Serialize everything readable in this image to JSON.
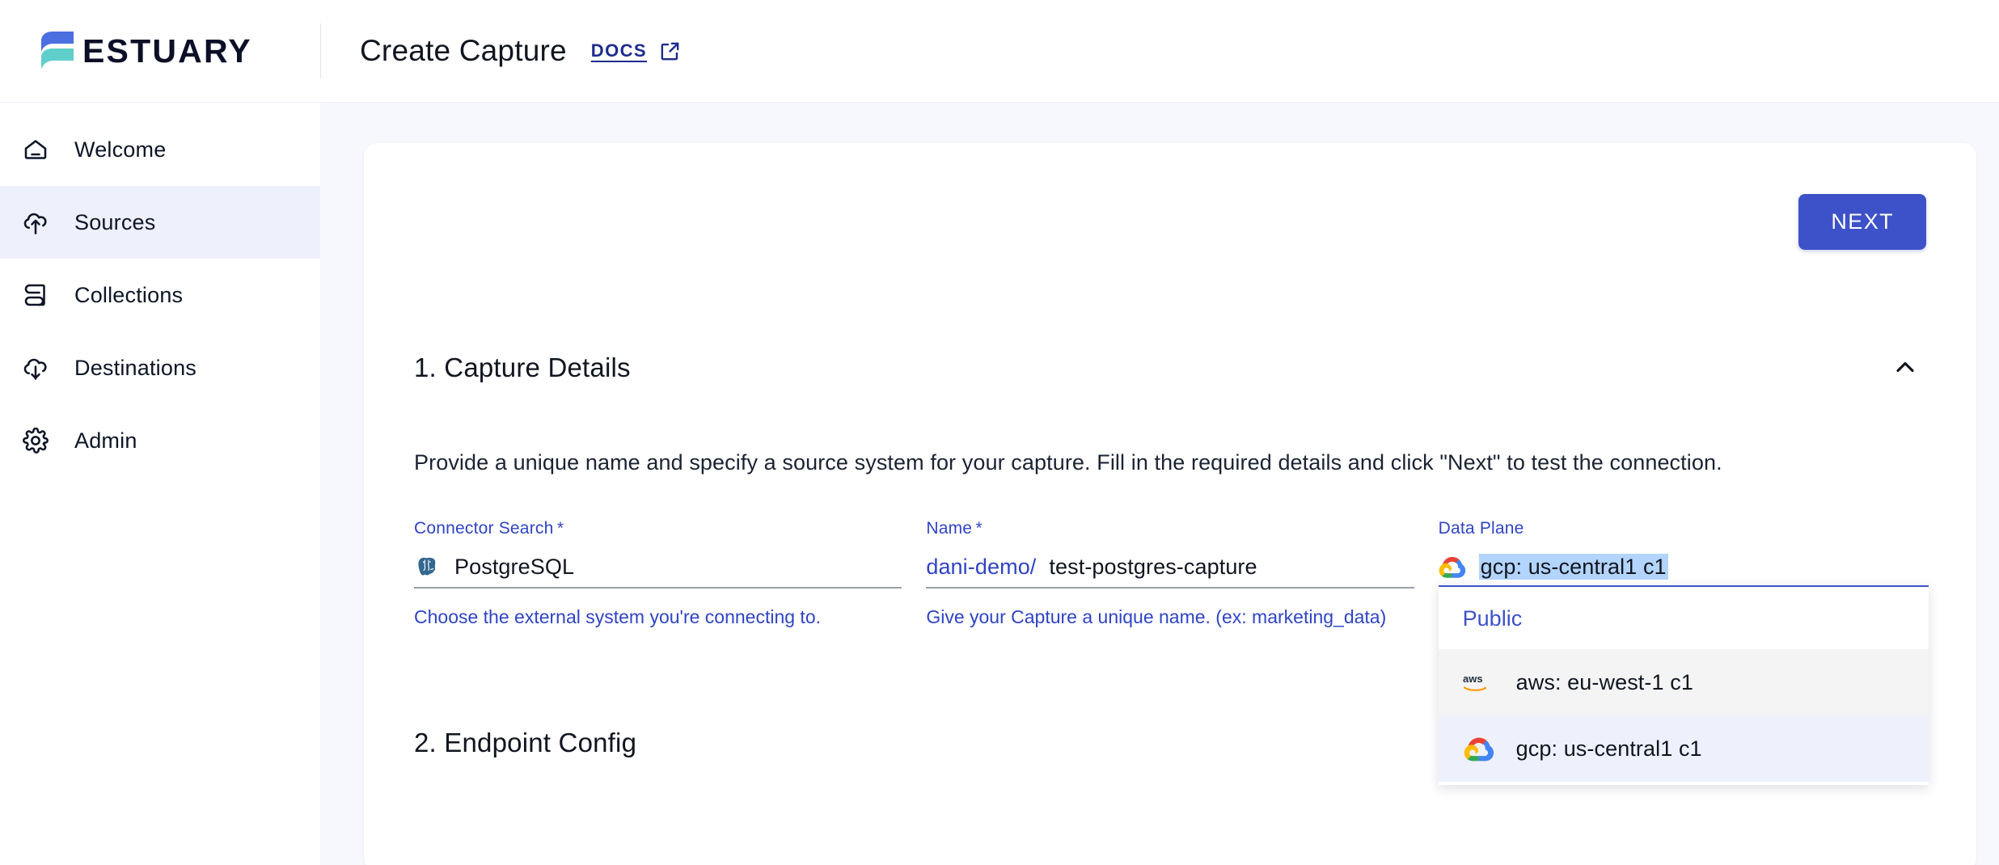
{
  "header": {
    "brand_name": "ESTUARY",
    "page_title": "Create Capture",
    "docs_label": "DOCS",
    "docs_icon": "external-link-icon",
    "logo_icon": "estuary-logo-icon",
    "colors": {
      "logo_blue": "#4b6ee0",
      "logo_teal": "#5fcfcb",
      "link": "#1d2c8e"
    }
  },
  "sidebar": {
    "items": [
      {
        "label": "Welcome",
        "icon": "home-icon",
        "active": false
      },
      {
        "label": "Sources",
        "icon": "cloud-upload-icon",
        "active": true
      },
      {
        "label": "Collections",
        "icon": "collections-icon",
        "active": false
      },
      {
        "label": "Destinations",
        "icon": "cloud-download-icon",
        "active": false
      },
      {
        "label": "Admin",
        "icon": "gear-icon",
        "active": false
      }
    ],
    "active_bg": "#eef1fb"
  },
  "main": {
    "next_button": "NEXT",
    "next_button_color": "#3d52c8",
    "section1": {
      "title": "1. Capture Details",
      "collapse_icon": "chevron-up-icon",
      "description": "Provide a unique name and specify a source system for your capture. Fill in the required details and click \"Next\" to test the connection.",
      "fields": [
        {
          "label": "Connector Search",
          "required": true,
          "icon": "postgresql-icon",
          "value": "PostgreSQL",
          "help": "Choose the external system you're connecting to."
        },
        {
          "label": "Name",
          "required": true,
          "prefix": "dani-demo/",
          "value": "test-postgres-capture",
          "help": "Give your Capture a unique name. (ex: marketing_data)"
        },
        {
          "label": "Data Plane",
          "required": false,
          "icon": "gcp-icon",
          "value": "gcp: us-central1 c1",
          "value_selected": true,
          "help": ""
        }
      ]
    },
    "dropdown": {
      "group_label": "Public",
      "options": [
        {
          "label": "aws: eu-west-1 c1",
          "icon": "aws-icon",
          "state": "hover"
        },
        {
          "label": "gcp: us-central1 c1",
          "icon": "gcp-icon",
          "state": "selected"
        }
      ]
    },
    "section2": {
      "title": "2. Endpoint Config"
    }
  }
}
